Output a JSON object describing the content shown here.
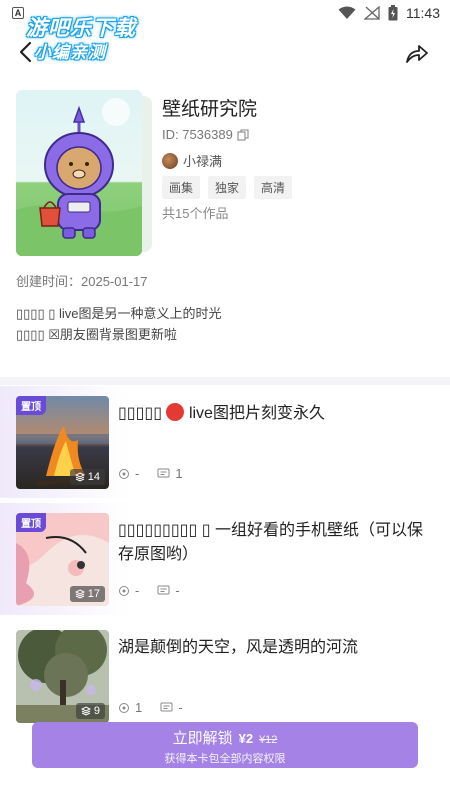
{
  "status_bar": {
    "time": "11:43",
    "badge": "A"
  },
  "watermark": {
    "line1": "游吧乐下载",
    "line2": "小编亲测"
  },
  "profile": {
    "title": "壁纸研究院",
    "id_text": "ID: 7536389",
    "author": "小禄满",
    "tags": [
      "画集",
      "独家",
      "高清"
    ],
    "works": "共15个作品",
    "created": "创建时间：2025-01-17",
    "desc_line1": "▯▯▯▯ ▯ live图是另一种意义上的时光",
    "desc_line2": "▯▯▯▯ ☒朋友圈背景图更新啦"
  },
  "items": [
    {
      "pinned": true,
      "pin_label": "置顶",
      "title_prefix": "▯▯▯▯▯",
      "title_rest": " live图把片刻变永久",
      "count": "14",
      "likes": "-",
      "comments": "1"
    },
    {
      "pinned": true,
      "pin_label": "置顶",
      "title_line": "▯▯▯▯▯▯▯▯▯ ▯ 一组好看的手机壁纸（可以保存原图哟）",
      "count": "17",
      "likes": "-",
      "comments": "-"
    },
    {
      "pinned": false,
      "title_line": "湖是颠倒的天空，风是透明的河流",
      "count": "9",
      "likes": "1",
      "comments": "-"
    }
  ],
  "unlock": {
    "label": "立即解锁",
    "price": "¥2",
    "old_price": "¥12",
    "sub": "获得本卡包全部内容权限"
  },
  "colors": {
    "accent": "#a582e6",
    "pin": "#6a4bd8"
  },
  "icons": [
    "back-icon",
    "share-icon",
    "copy-icon",
    "layers-icon",
    "like-icon",
    "comment-icon",
    "wifi-icon",
    "battery-icon"
  ]
}
